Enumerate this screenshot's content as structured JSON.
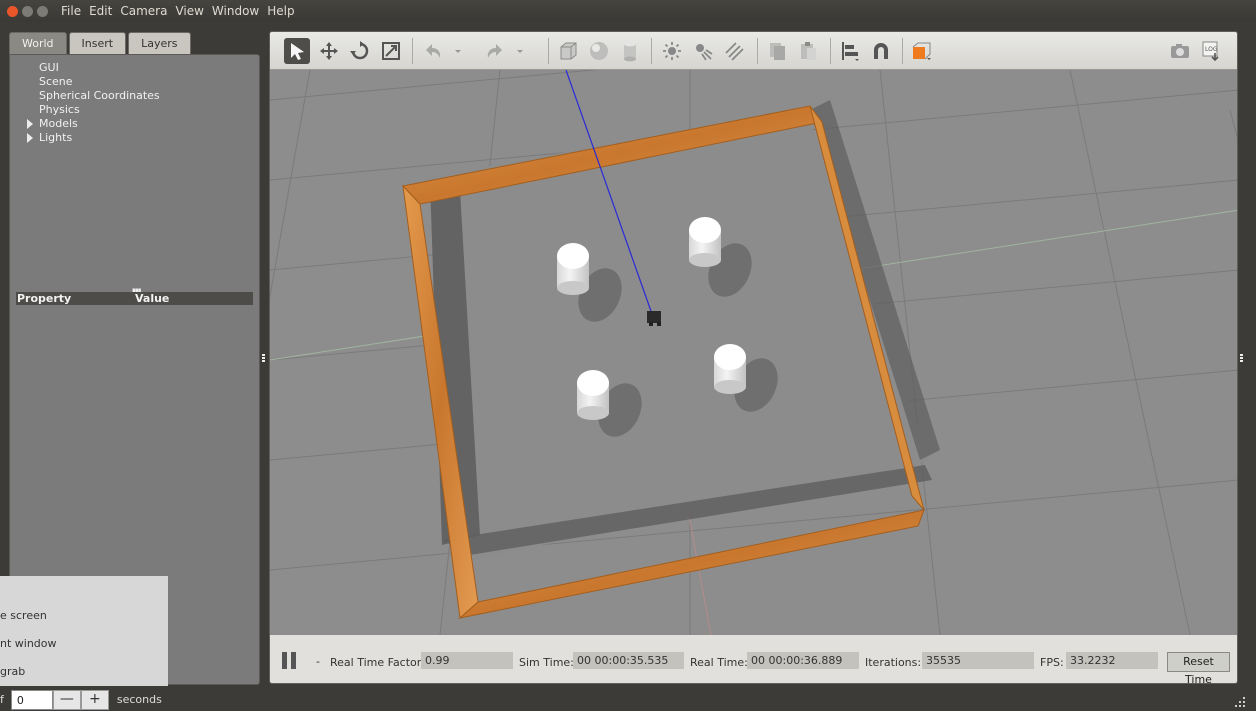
{
  "menubar": {
    "items": [
      "File",
      "Edit",
      "Camera",
      "View",
      "Window",
      "Help"
    ]
  },
  "left_panel": {
    "tabs": [
      "World",
      "Insert",
      "Layers"
    ],
    "tree": [
      {
        "label": "GUI",
        "expandable": false
      },
      {
        "label": "Scene",
        "expandable": false
      },
      {
        "label": "Spherical Coordinates",
        "expandable": false
      },
      {
        "label": "Physics",
        "expandable": false
      },
      {
        "label": "Models",
        "expandable": true
      },
      {
        "label": "Lights",
        "expandable": true
      }
    ],
    "property_header": {
      "property": "Property",
      "value": "Value"
    }
  },
  "popup": {
    "items": [
      "e screen",
      "nt window",
      "grab"
    ]
  },
  "delay_bar": {
    "prefix": "f",
    "value": "0",
    "minus": "—",
    "plus": "+",
    "unit": "seconds"
  },
  "toolbar": {
    "icons": [
      "select-mode-icon",
      "translate-mode-icon",
      "rotate-mode-icon",
      "scale-mode-icon",
      "undo-icon",
      "undo-dropdown-icon",
      "redo-icon",
      "redo-dropdown-icon",
      "box-shape-icon",
      "sphere-shape-icon",
      "cylinder-shape-icon",
      "point-light-icon",
      "spot-light-icon",
      "directional-light-icon",
      "copy-icon",
      "paste-icon",
      "align-icon",
      "snap-icon",
      "view-angle-icon",
      "screenshot-icon",
      "log-icon"
    ]
  },
  "status": {
    "step": "-",
    "real_time_factor_label": "Real Time Factor:",
    "real_time_factor": "0.99",
    "sim_time_label": "Sim Time:",
    "sim_time": "00 00:00:35.535",
    "real_time_label": "Real Time:",
    "real_time": "00 00:00:36.889",
    "iterations_label": "Iterations:",
    "iterations": "35535",
    "fps_label": "FPS:",
    "fps": "33.2232",
    "reset_label": "Reset Time"
  },
  "colors": {
    "accent_close": "#e9562a",
    "wall_wood": "#d98a3c",
    "ground": "#8c8c8c",
    "toolbar_bg": "#e1e0dc",
    "view_angle_orange": "#f07b1e"
  }
}
